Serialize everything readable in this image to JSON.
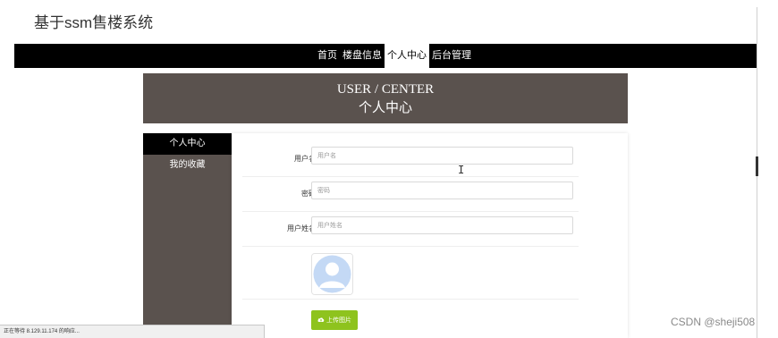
{
  "site": {
    "title": "基于ssm售楼系统"
  },
  "nav": {
    "items": [
      {
        "label": "首页",
        "active": false
      },
      {
        "label": "楼盘信息",
        "active": false
      },
      {
        "label": "个人中心",
        "active": true
      },
      {
        "label": "后台管理",
        "active": false
      }
    ]
  },
  "banner": {
    "en": "USER / CENTER",
    "zh": "个人中心"
  },
  "sidebar": {
    "items": [
      {
        "label": "个人中心",
        "active": true
      },
      {
        "label": "我的收藏",
        "active": false
      }
    ]
  },
  "form": {
    "fields": [
      {
        "label": "用户名",
        "placeholder": "用户名"
      },
      {
        "label": "密码",
        "placeholder": "密码"
      },
      {
        "label": "用户姓名",
        "placeholder": "用户姓名"
      }
    ],
    "avatar_icon": "user-avatar-icon",
    "upload_label": "上传图片",
    "upload_icon": "cloud-upload-icon"
  },
  "status_bar": {
    "text": "正在等待 8.129.11.174 的响应..."
  },
  "watermark": {
    "text": "CSDN @sheji508"
  },
  "colors": {
    "nav_bg": "#000000",
    "banner_bg": "#5a524e",
    "sidebar_bg": "#5a524e",
    "upload_button": "#8ec31e"
  }
}
